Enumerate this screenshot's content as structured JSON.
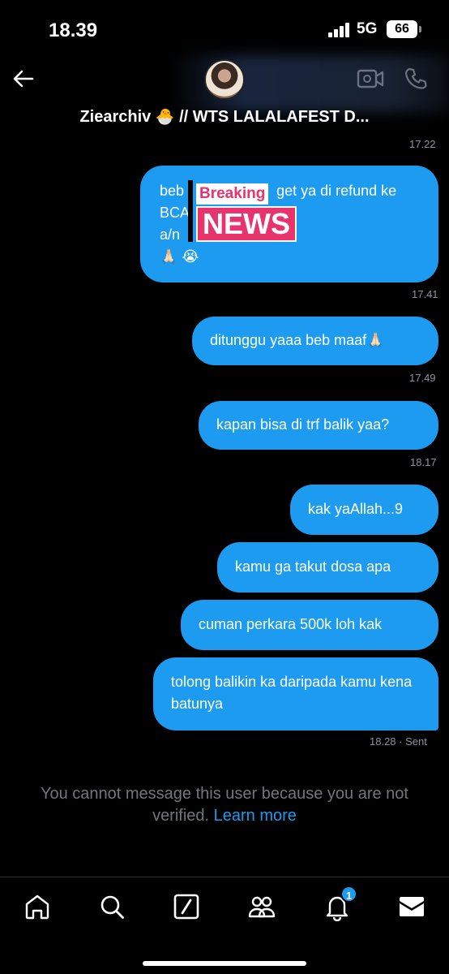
{
  "status_bar": {
    "time": "18.39",
    "network": "5G",
    "battery": "66"
  },
  "header": {
    "name": "Ziearchiv",
    "title_rest": "// WTS LALALAFEST D...",
    "back_icon": "arrow-left-icon",
    "video_icon": "video-camera-icon",
    "call_icon": "phone-icon"
  },
  "messages": [
    {
      "time": "17.22"
    },
    {
      "line1_a": "beb",
      "line1_b": "get ya di refund ke",
      "line2": "BCA",
      "line3": "a/n",
      "emoji": "🙏🏻 😭",
      "time": "17.41"
    },
    {
      "text": "ditunggu yaaa beb maaf🙏🏻",
      "time": "17.49"
    },
    {
      "text": "kapan bisa di trf balik yaa?",
      "time": "18.17"
    },
    {
      "text": "kak yaAllah...9"
    },
    {
      "text": "kamu ga takut dosa apa"
    },
    {
      "text": "cuman perkara 500k loh kak"
    },
    {
      "text": "tolong balikin ka daripada kamu kena batunya",
      "time": "18.28",
      "status": "Sent"
    }
  ],
  "overlay": {
    "breaking": "Breaking",
    "news": "NEWS"
  },
  "notice": {
    "text": "You cannot message this user because you are not verified.",
    "link": "Learn more"
  },
  "nav": {
    "items": [
      "home-icon",
      "search-icon",
      "grok-icon",
      "communities-icon",
      "notifications-icon",
      "messages-icon"
    ],
    "notification_count": "1"
  },
  "colors": {
    "bubble": "#1d9bf0",
    "background": "#000000",
    "timestamp": "#8b949e",
    "link": "#1d9bf0",
    "overlay_pink": "#e8336c"
  }
}
